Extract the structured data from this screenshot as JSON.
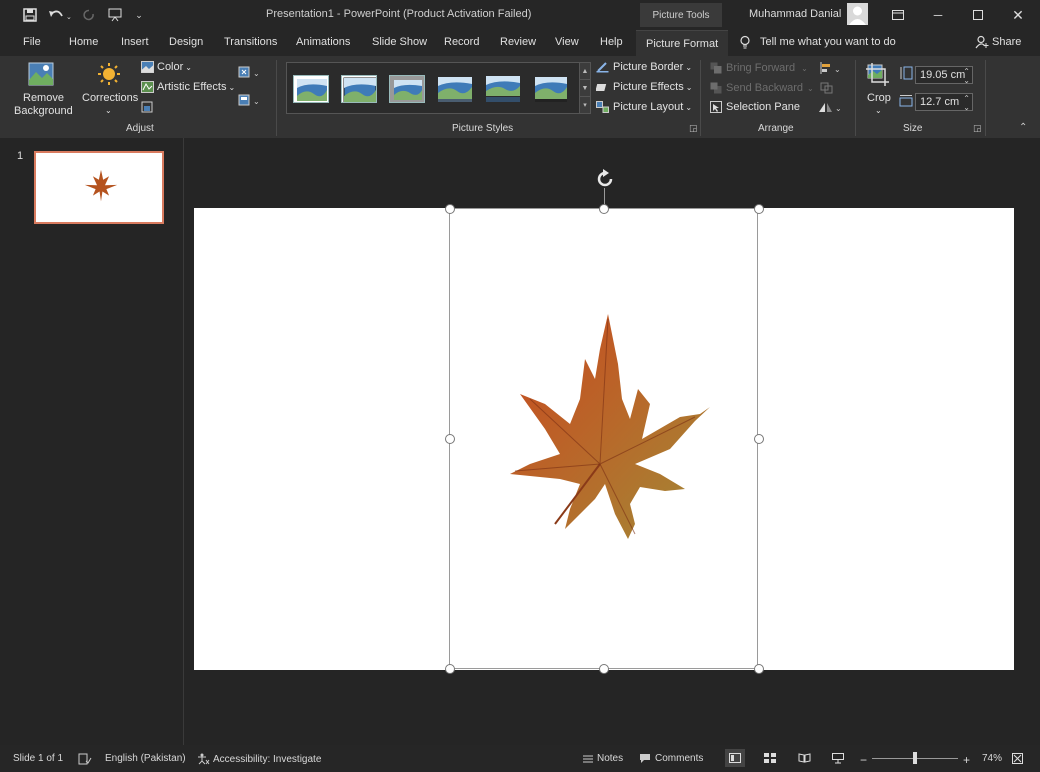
{
  "titlebar": {
    "doc_title": "Presentation1 - PowerPoint (Product Activation Failed)",
    "context_tab": "Picture Tools",
    "user_name": "Muhammad Danial"
  },
  "tabs": [
    {
      "label": "File"
    },
    {
      "label": "Home"
    },
    {
      "label": "Insert"
    },
    {
      "label": "Design"
    },
    {
      "label": "Transitions"
    },
    {
      "label": "Animations"
    },
    {
      "label": "Slide Show"
    },
    {
      "label": "Record"
    },
    {
      "label": "Review"
    },
    {
      "label": "View"
    },
    {
      "label": "Help"
    },
    {
      "label": "Picture Format",
      "active": true
    }
  ],
  "tell_me": "Tell me what you want to do",
  "share": "Share",
  "ribbon": {
    "adjust": {
      "remove_bg_line1": "Remove",
      "remove_bg_line2": "Background",
      "corrections": "Corrections",
      "color": "Color",
      "artistic": "Artistic Effects",
      "label": "Adjust"
    },
    "styles": {
      "border": "Picture Border",
      "effects": "Picture Effects",
      "layout": "Picture Layout",
      "label": "Picture Styles"
    },
    "arrange": {
      "bring_forward": "Bring Forward",
      "send_backward": "Send Backward",
      "selection_pane": "Selection Pane",
      "label": "Arrange"
    },
    "size": {
      "crop": "Crop",
      "height": "19.05 cm",
      "width": "12.7 cm",
      "label": "Size"
    }
  },
  "slides_pane": {
    "slide_number": "1"
  },
  "status": {
    "slide_of": "Slide 1 of 1",
    "language": "English (Pakistan)",
    "accessibility": "Accessibility: Investigate",
    "notes": "Notes",
    "comments": "Comments",
    "zoom": "74%",
    "zoom_fraction": 0.5
  },
  "colors": {
    "accent_thumb_border": "#d97b5f",
    "ribbon_bg": "#333333",
    "title_bg": "#262626"
  }
}
